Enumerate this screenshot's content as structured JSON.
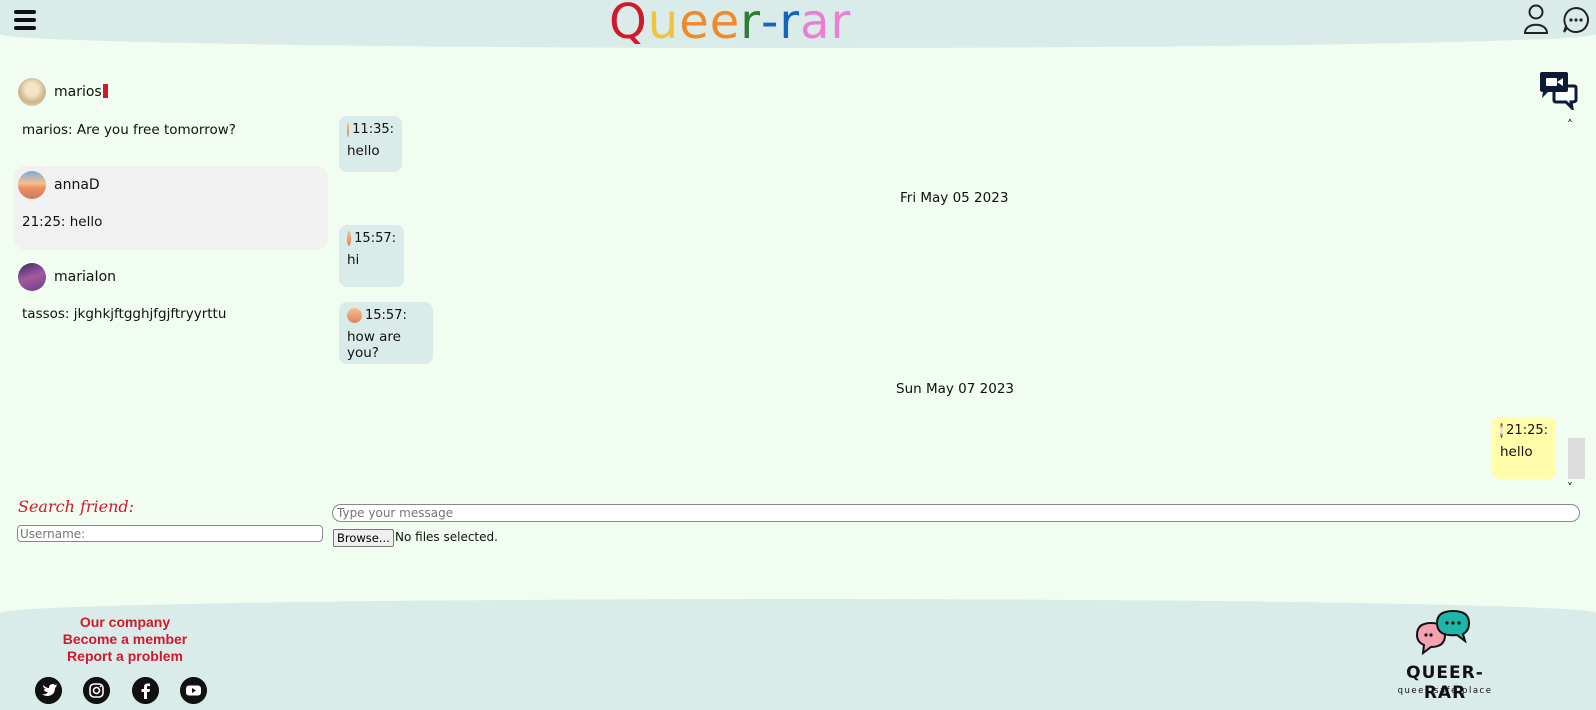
{
  "header": {
    "logo_letters": [
      {
        "ch": "Q",
        "color": "#d2182b"
      },
      {
        "ch": "u",
        "color": "#f2c23a"
      },
      {
        "ch": "e",
        "color": "#f0892a"
      },
      {
        "ch": "e",
        "color": "#f0892a"
      },
      {
        "ch": "r",
        "color": "#2e7d32"
      },
      {
        "ch": "-",
        "color": "#1565c0"
      },
      {
        "ch": "r",
        "color": "#1565c0"
      },
      {
        "ch": "a",
        "color": "#ec7fd4"
      },
      {
        "ch": "r",
        "color": "#ec7fd4"
      }
    ]
  },
  "conversations": [
    {
      "name": "marios",
      "last_message": "marios: Are you free tomorrow?",
      "unread": true,
      "active": false
    },
    {
      "name": "annaD",
      "last_message": "21:25: hello",
      "unread": false,
      "active": true
    },
    {
      "name": "mariaIon",
      "last_message": "tassos: jkghkjftgghjfgjftryyrttu",
      "unread": false,
      "active": false
    }
  ],
  "messages": [
    {
      "time": "11:35:",
      "text": "hello",
      "direction": "in"
    },
    {
      "date_separator": "Fri May 05 2023"
    },
    {
      "time": "15:57:",
      "text": "hi",
      "direction": "in"
    },
    {
      "time": "15:57:",
      "text": "how are you?",
      "direction": "in"
    },
    {
      "date_separator": "Sun May 07 2023"
    },
    {
      "time": "21:25:",
      "text": "hello",
      "direction": "out"
    }
  ],
  "search": {
    "title": "Search friend:",
    "placeholder": "Username:"
  },
  "composer": {
    "placeholder": "Type your message",
    "browse_label": "Browse...",
    "file_status": "No files selected."
  },
  "footer": {
    "links": [
      "Our company",
      "Become a member",
      "Report a problem"
    ],
    "social_icons": [
      "twitter-icon",
      "instagram-icon",
      "facebook-icon",
      "youtube-icon"
    ],
    "brand_name": "QUEER-RAR",
    "brand_tagline": "queer safe place"
  },
  "colors": {
    "background": "#f1fdf0",
    "header_footer": "#daecea",
    "incoming_bubble": "#daecea",
    "outgoing_bubble": "#fffdaa",
    "accent_red": "#d2182b"
  }
}
